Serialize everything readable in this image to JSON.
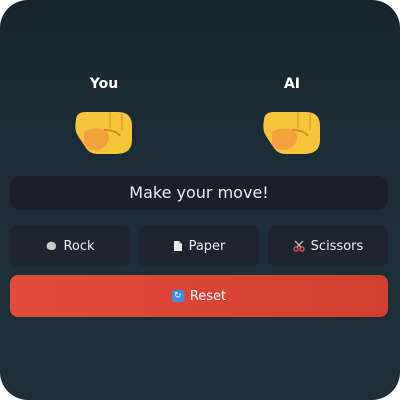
{
  "players": {
    "you": {
      "label": "You",
      "choice_icon": "fist-icon"
    },
    "ai": {
      "label": "AI",
      "choice_icon": "fist-icon"
    }
  },
  "status": {
    "message": "Make your move!"
  },
  "moves": {
    "rock": {
      "label": "Rock",
      "icon": "rock-icon"
    },
    "paper": {
      "label": "Paper",
      "icon": "paper-icon"
    },
    "scissors": {
      "label": "Scissors",
      "icon": "scissors-icon"
    }
  },
  "reset": {
    "label": "Reset",
    "icon": "refresh-icon"
  },
  "colors": {
    "background": "#1b2d37",
    "status_bg": "#1a1f2a",
    "button_bg": "#1f2530",
    "reset_bg": "#e34b3c"
  }
}
